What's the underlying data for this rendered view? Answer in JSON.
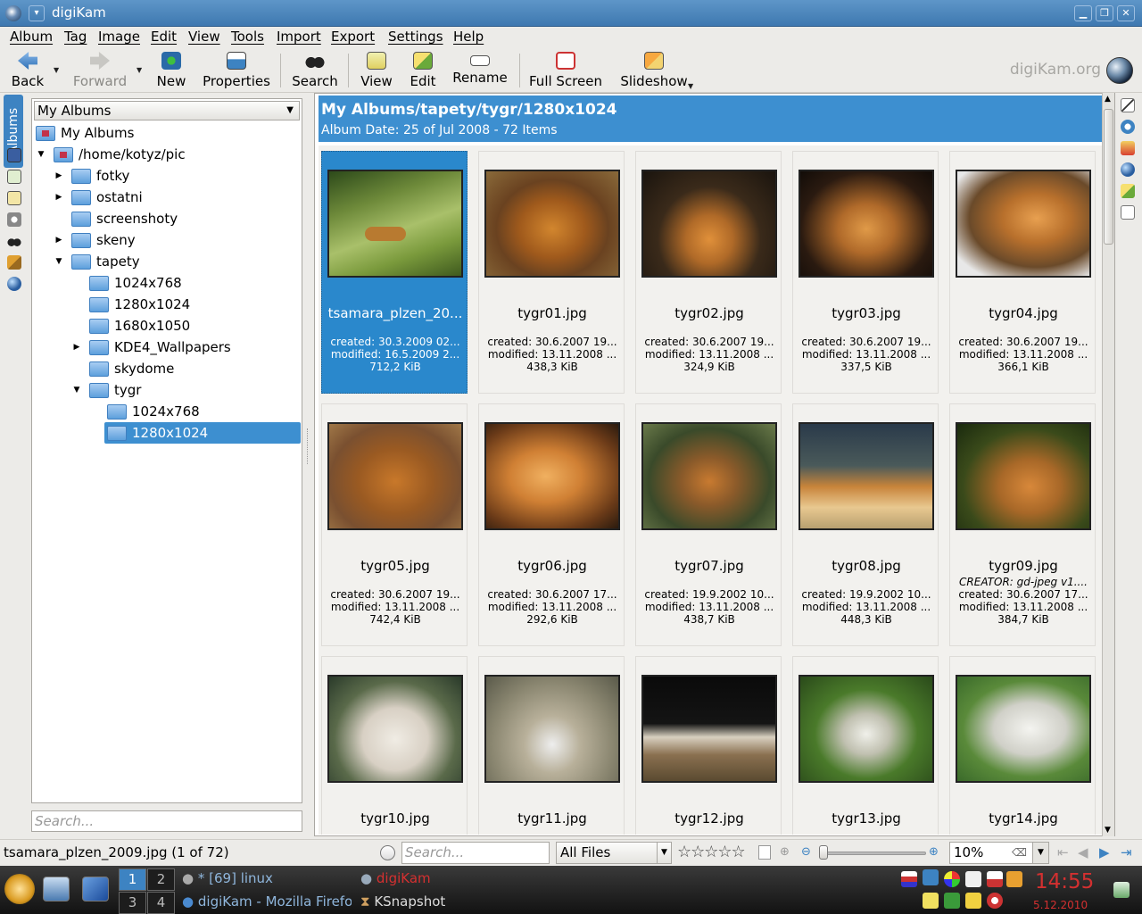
{
  "window": {
    "title": "digiKam"
  },
  "menubar": [
    "Album",
    "Tag",
    "Image",
    "Edit",
    "View",
    "Tools",
    "Import",
    "Export",
    "Settings",
    "Help"
  ],
  "toolbar": {
    "back": "Back",
    "forward": "Forward",
    "new": "New",
    "properties": "Properties",
    "search": "Search",
    "view": "View",
    "edit": "Edit",
    "rename": "Rename",
    "fullscreen": "Full Screen",
    "slideshow": "Slideshow",
    "brand": "digiKam.org"
  },
  "sidebar": {
    "tab": "Albums"
  },
  "album_panel": {
    "selector": "My Albums",
    "tree": [
      {
        "label": "My Albums"
      },
      {
        "label": "/home/kotyz/pic"
      },
      {
        "label": "fotky"
      },
      {
        "label": "ostatni"
      },
      {
        "label": "screenshoty"
      },
      {
        "label": "skeny"
      },
      {
        "label": "tapety"
      },
      {
        "label": "1024x768"
      },
      {
        "label": "1280x1024"
      },
      {
        "label": "1680x1050"
      },
      {
        "label": "KDE4_Wallpapers"
      },
      {
        "label": "skydome"
      },
      {
        "label": "tygr"
      },
      {
        "label": "1024x768"
      },
      {
        "label": "1280x1024"
      }
    ],
    "search_placeholder": "Search..."
  },
  "header": {
    "path": "My Albums/tapety/tygr/1280x1024",
    "subtitle": "Album Date: 25 of Jul 2008 - 72 Items"
  },
  "images": [
    {
      "name": "tsamara_plzen_20...",
      "created": "created: 30.3.2009 02...",
      "modified": "modified: 16.5.2009 2...",
      "size": "712,2 KiB",
      "selected": true
    },
    {
      "name": "tygr01.jpg",
      "created": "created: 30.6.2007 19...",
      "modified": "modified: 13.11.2008 ...",
      "size": "438,3 KiB"
    },
    {
      "name": "tygr02.jpg",
      "created": "created: 30.6.2007 19...",
      "modified": "modified: 13.11.2008 ...",
      "size": "324,9 KiB"
    },
    {
      "name": "tygr03.jpg",
      "created": "created: 30.6.2007 19...",
      "modified": "modified: 13.11.2008 ...",
      "size": "337,5 KiB"
    },
    {
      "name": "tygr04.jpg",
      "created": "created: 30.6.2007 19...",
      "modified": "modified: 13.11.2008 ...",
      "size": "366,1 KiB"
    },
    {
      "name": "tygr05.jpg",
      "created": "created: 30.6.2007 19...",
      "modified": "modified: 13.11.2008 ...",
      "size": "742,4 KiB"
    },
    {
      "name": "tygr06.jpg",
      "created": "created: 30.6.2007 17...",
      "modified": "modified: 13.11.2008 ...",
      "size": "292,6 KiB"
    },
    {
      "name": "tygr07.jpg",
      "created": "created: 19.9.2002 10...",
      "modified": "modified: 13.11.2008 ...",
      "size": "438,7 KiB"
    },
    {
      "name": "tygr08.jpg",
      "created": "created: 19.9.2002 10...",
      "modified": "modified: 13.11.2008 ...",
      "size": "448,3 KiB"
    },
    {
      "name": "tygr09.jpg",
      "comment": "CREATOR: gd-jpeg v1....",
      "created": "created: 30.6.2007 17...",
      "modified": "modified: 13.11.2008 ...",
      "size": "384,7 KiB"
    },
    {
      "name": "tygr10.jpg"
    },
    {
      "name": "tygr11.jpg"
    },
    {
      "name": "tygr12.jpg"
    },
    {
      "name": "tygr13.jpg"
    },
    {
      "name": "tygr14.jpg"
    }
  ],
  "statusbar": {
    "text": "tsamara_plzen_2009.jpg (1 of 72)",
    "search_placeholder": "Search...",
    "filter": "All Files",
    "zoom": "10%"
  },
  "taskbar": {
    "desktops": [
      "1",
      "2",
      "3",
      "4"
    ],
    "tasks": [
      "* [69] linux",
      "digiKam",
      "digiKam - Mozilla Firefox",
      "KSnapshot"
    ],
    "time": "14:55",
    "date": "5.12.2010"
  }
}
